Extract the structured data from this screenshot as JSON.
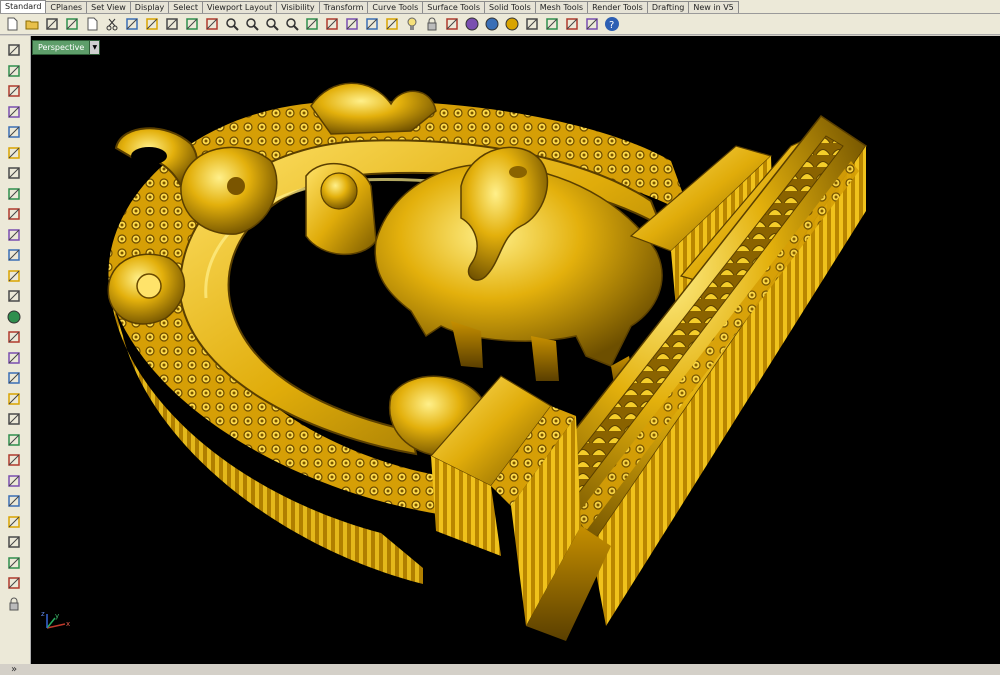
{
  "tabs": [
    "Standard",
    "CPlanes",
    "Set View",
    "Display",
    "Select",
    "Viewport Layout",
    "Visibility",
    "Transform",
    "Curve Tools",
    "Surface Tools",
    "Solid Tools",
    "Mesh Tools",
    "Render Tools",
    "Drafting",
    "New in V5"
  ],
  "active_tab": "Standard",
  "toolbar_icons": [
    "new-file-icon",
    "open-folder-icon",
    "save-icon",
    "print-icon",
    "import-icon",
    "cut-icon",
    "copy-icon",
    "paste-icon",
    "undo-icon",
    "pan-hand-icon",
    "move-icon",
    "zoom-icon",
    "zoom-window-icon",
    "zoom-extents-icon",
    "zoom-selected-icon",
    "rotate-view-icon",
    "four-viewports-icon",
    "cplane-icon",
    "snap-icon",
    "object-properties-icon",
    "light-bulb-icon",
    "lock-icon",
    "layer-icon",
    "render-color-icon",
    "sphere-shaded-icon",
    "render-sphere-icon",
    "material-icon",
    "pin-icon",
    "options-gear-icon",
    "select-filter-icon",
    "help-icon"
  ],
  "sidebar_icons": [
    "select-arrow-icon",
    "point-icon",
    "polyline-icon",
    "curve-icon",
    "circle-icon",
    "ellipse-icon",
    "polygon-icon",
    "rectangle-icon",
    "arc-icon",
    "fillet-icon",
    "surface-icon",
    "extrude-icon",
    "box-solid-icon",
    "sphere-solid-icon",
    "cylinder-solid-icon",
    "mesh-icon",
    "move-arrow-icon",
    "transform-icon",
    "split-icon",
    "boolean-icon",
    "group-icon",
    "rotate-icon",
    "offset-icon",
    "text-icon",
    "dimension-icon",
    "array-icon",
    "group-objects-icon",
    "block-icon"
  ],
  "sidebar_more": "»",
  "viewport": {
    "label": "Perspective",
    "dropdown": "▼"
  },
  "axes": {
    "x": "x",
    "y": "y",
    "z": "z"
  },
  "colors": {
    "gold": "#e8b80c",
    "gold_dark": "#7a5a00",
    "gold_light": "#ffe36a",
    "background": "#000000",
    "accent": "#5e9e6a"
  }
}
